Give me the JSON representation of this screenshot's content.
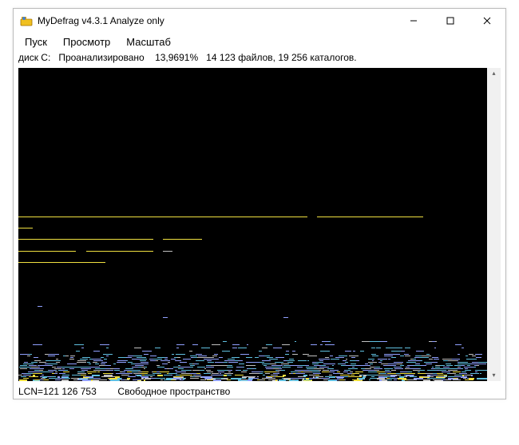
{
  "titlebar": {
    "title": "MyDefrag v4.3.1    Analyze only"
  },
  "menubar": {
    "items": [
      "Пуск",
      "Просмотр",
      "Масштаб"
    ]
  },
  "status_top": {
    "disk_label": "диск C:",
    "state": "Проанализировано",
    "percent": "13,9691%",
    "files_count": "14 123",
    "files_word": "файлов,",
    "dirs_count": "19 256",
    "dirs_word": "каталогов."
  },
  "status_bottom": {
    "lcn_label": "LCN=",
    "lcn_value": "121 126 753",
    "space_label": "Свободное пространство"
  },
  "window_controls": {
    "minimize": "minimize",
    "maximize": "maximize",
    "close": "close"
  }
}
